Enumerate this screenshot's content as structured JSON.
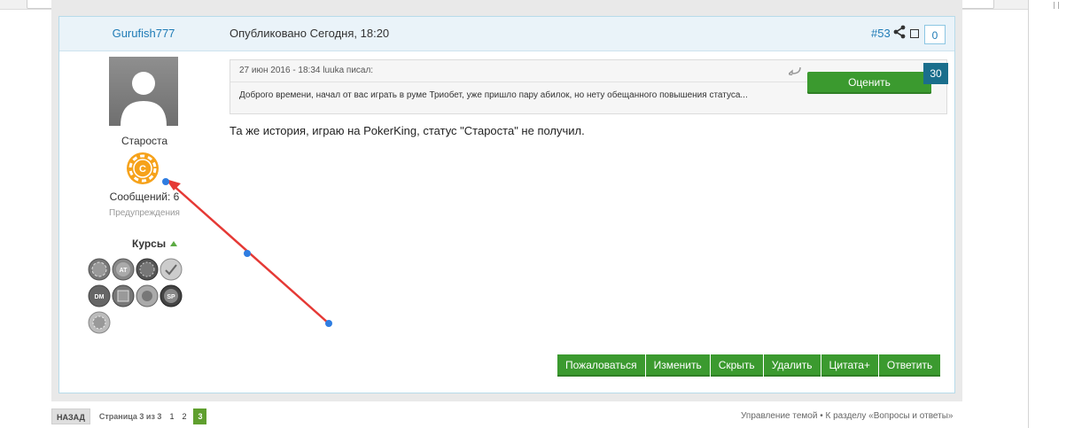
{
  "post": {
    "author": "Gurufish777",
    "posted": "Опубликовано Сегодня, 18:20",
    "post_number": "#53",
    "counter": "0",
    "rank": "Староста",
    "badge_letter": "C",
    "messages": "Сообщений: 6",
    "warnings": "Предупреждения",
    "courses_label": "Курсы",
    "chips": [
      "DM",
      "SP",
      "AT"
    ],
    "quote": {
      "header": "27 июн 2016 - 18:34 luuka писал:",
      "text": "Доброго времени, начал от вас играть в руме Триобет, уже пришло пару абилок, но нету обещанного повышения статуса..."
    },
    "rate_label": "Оценить",
    "rate_count": "30",
    "body": "Та же история, играю на PokerKing, статус \"Староста\" не получил.",
    "actions": [
      "Пожаловаться",
      "Изменить",
      "Скрыть",
      "Удалить",
      "Цитата+",
      "Ответить"
    ]
  },
  "pager": {
    "back": "НАЗАД",
    "page_of": "Страница 3 из 3",
    "pages": [
      "1",
      "2",
      "3"
    ],
    "current": "3"
  },
  "footer": {
    "links": "Управление темой • К разделу «Вопросы и ответы»"
  },
  "colors": {
    "accent_green": "#3b9a2f",
    "link_blue": "#1f7bb6",
    "annotation_red": "#e53935",
    "annotation_blue": "#2f7de1"
  }
}
